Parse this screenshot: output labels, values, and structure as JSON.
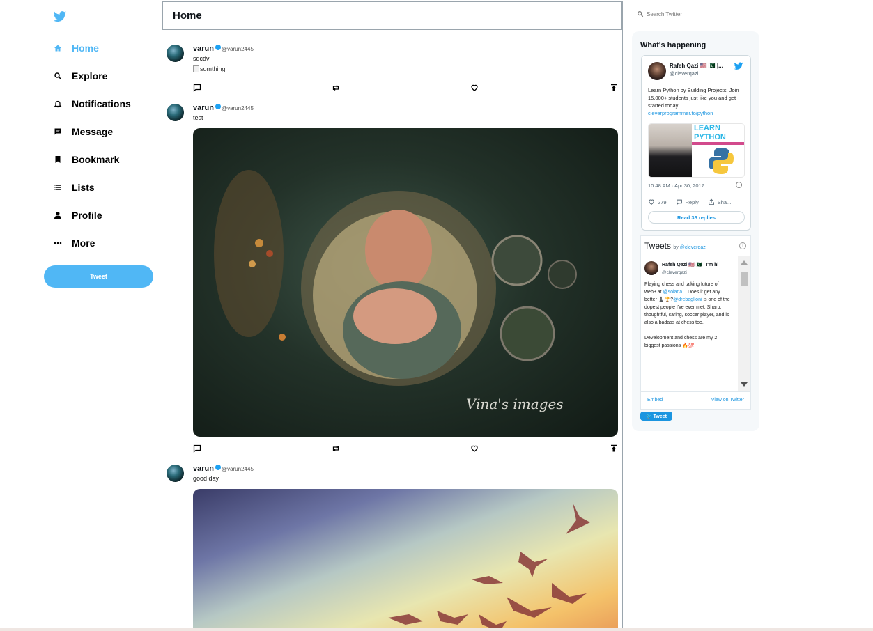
{
  "sidebar": {
    "items": [
      {
        "label": "Home",
        "icon": "home-icon",
        "active": true
      },
      {
        "label": "Explore",
        "icon": "search-icon"
      },
      {
        "label": "Notifications",
        "icon": "bell-icon"
      },
      {
        "label": "Message",
        "icon": "message-icon"
      },
      {
        "label": "Bookmark",
        "icon": "bookmark-icon"
      },
      {
        "label": "Lists",
        "icon": "list-icon"
      },
      {
        "label": "Profile",
        "icon": "person-icon"
      },
      {
        "label": "More",
        "icon": "more-icon"
      }
    ],
    "tweet_button": "Tweet"
  },
  "feed": {
    "title": "Home",
    "posts": [
      {
        "name": "varun",
        "handle": "@varun2445",
        "text": "sdcdv",
        "image_alt": "somthing"
      },
      {
        "name": "varun",
        "handle": "@varun2445",
        "text": "test",
        "image_watermark": "Vina's images"
      },
      {
        "name": "varun",
        "handle": "@varun2445",
        "text": "good day"
      }
    ]
  },
  "search": {
    "placeholder": "Search Twitter"
  },
  "widgets": {
    "title": "What's happening",
    "embed": {
      "name": "Rafeh Qazi 🇺🇸 🇵🇰 |...",
      "handle": "@cleverqazi",
      "text": "Learn Python by Building Projects. Join 15,000+ students just like you and get started today!",
      "link": "cleverprogrammer.to/python",
      "media_text_1": "LEARN",
      "media_text_2": "PYTHON",
      "time": "10:48 AM · Apr 30, 2017",
      "likes": "279",
      "reply_label": "Reply",
      "share_label": "Sha...",
      "read_replies": "Read 36 replies"
    },
    "timeline": {
      "title": "Tweets",
      "by": "by",
      "by_handle": "@cleverqazi",
      "tweet_name": "Rafeh Qazi 🇺🇸 🇵🇰 | I'm hi",
      "tweet_handle": "@cleverqazi",
      "tweet_text_1": "Playing chess and talking future of web3 at ",
      "tweet_link_1": "@solana",
      "tweet_text_2": "... Does it get any better ♟️🏆?",
      "tweet_link_2": "@drebaglioni",
      "tweet_text_3": " is one of the dopest people I've ever met. Sharp, thoughtful, caring, soccer player, and is also a badass at chess too.",
      "tweet_text_4": "Development and chess are my 2 biggest passions 🔥💯!",
      "embed_label": "Embed",
      "view_label": "View on Twitter"
    },
    "tweet_button": "🐦 Tweet"
  },
  "colors": {
    "accent": "#50b7f5",
    "twitter_blue": "#1da1f2",
    "link": "#1b95e0"
  }
}
